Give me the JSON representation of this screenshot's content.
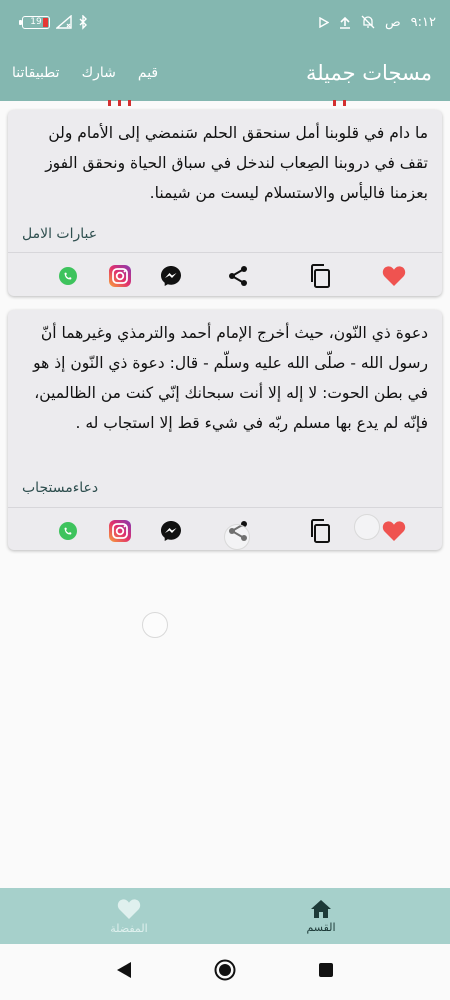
{
  "status_bar": {
    "time": "٩:١٢",
    "am_pm": "ص",
    "battery": "19"
  },
  "app_bar": {
    "title": "مسجات جميلة",
    "actions": [
      "قيم",
      "شارك",
      "تطبيقاتنا"
    ]
  },
  "cards": [
    {
      "text": "ما دام في قلوبنا أمل سنحقق الحلم سَنمضي إلى الأمام ولن تقف في دروبنا الصِعاب لندخل في سباق الحياة ونحقق الفوز بعزمنا فاليأس والاستسلام ليست من شيمنا.",
      "category": "عبارات الامل",
      "favorited": true
    },
    {
      "text": "دعوة ذي النّون، حيث أخرج الإمام أحمد والترمذي وغيرهما أنّ رسول الله - صلّى الله عليه وسلّم - قال: دعوة ذي النّون إذ هو في بطن الحوت: لا إله إلا أنت سبحانك إنّي كنت من الظالمين، فإنّه لم يدع بها مسلم ربّه في شيء قط إلا استجاب له .",
      "category": "دعاءمستجاب",
      "favorited": true
    }
  ],
  "bottom_nav": {
    "items": [
      {
        "label": "القسم",
        "icon": "home-icon",
        "active": true
      },
      {
        "label": "المفضلة",
        "icon": "heart-icon",
        "active": false
      }
    ]
  },
  "colors": {
    "primary": "#84b7b0",
    "bottom_nav": "#a6d0cb",
    "card": "#ecebee",
    "heart": "#ef5350"
  }
}
